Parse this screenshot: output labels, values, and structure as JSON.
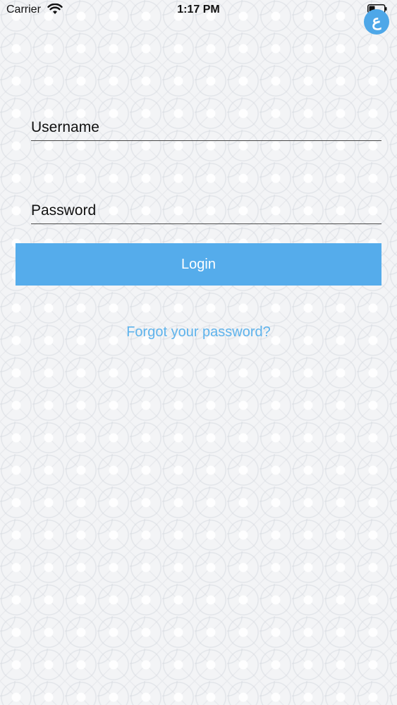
{
  "status_bar": {
    "carrier": "Carrier",
    "time": "1:17 PM",
    "wifi_icon": "wifi-icon",
    "battery_icon": "battery-icon"
  },
  "app_badge": {
    "glyph": "ع",
    "color": "#4ea7e8"
  },
  "form": {
    "username_placeholder": "Username",
    "username_value": "",
    "password_placeholder": "Password",
    "password_value": "",
    "login_label": "Login",
    "login_color": "#55aceb",
    "forgot_label": "Forgot your password?",
    "forgot_color": "#5eb3ec"
  }
}
